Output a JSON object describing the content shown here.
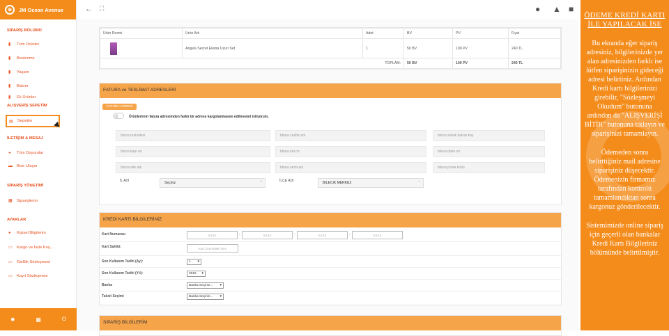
{
  "brand": {
    "name": "JM Ocean Avenue",
    "logo_glyph": "⊛"
  },
  "sidebar": {
    "sections": [
      {
        "title": "SİPARİŞ BÖLÜMÜ"
      },
      {
        "title": "ALIŞVERİŞ SEPETİM"
      },
      {
        "title": "İLETİŞİM & MESAJ"
      },
      {
        "title": "SİPARİŞ YÖNETİMİ"
      },
      {
        "title": "AYARLAR"
      }
    ],
    "items": [
      {
        "label": "Tüm Ürünler",
        "icon": "bookmark-icon"
      },
      {
        "label": "Beslenme",
        "icon": "bookmark-icon"
      },
      {
        "label": "Yaşam",
        "icon": "bookmark-icon"
      },
      {
        "label": "Bakım",
        "icon": "bookmark-icon"
      },
      {
        "label": "Ek Ürünler",
        "icon": "bookmark-icon"
      },
      {
        "label": "Sepetim",
        "icon": "cart-icon"
      },
      {
        "label": "Tüm Duyurular",
        "icon": "megaphone-icon"
      },
      {
        "label": "Bize Ulaşın",
        "icon": "message-icon"
      },
      {
        "label": "Siparişlerim",
        "icon": "grid-icon"
      },
      {
        "label": "Kişisel Bilgilerim",
        "icon": "info-icon"
      },
      {
        "label": "Kargo ve İade Koş...",
        "icon": "truck-icon"
      },
      {
        "label": "Gizlilik Sözleşmesi",
        "icon": "doc-icon"
      },
      {
        "label": "Kayıt Sözleşmesi",
        "icon": "doc-icon"
      }
    ],
    "footer_icons": [
      "gear-icon",
      "apps-icon",
      "power-icon"
    ]
  },
  "product_table": {
    "headers": [
      "Ürün Resmi",
      "Ürün Adı",
      "Adet",
      "BV",
      "PV",
      "Fiyat"
    ],
    "rows": [
      [
        "",
        "Angels Secret Ekstra Uzun Set",
        "1",
        "50 BV",
        "100 PV",
        "240 TL"
      ]
    ],
    "total_label": "TOPLAM:",
    "total_bv": "50 BV",
    "total_pv": "100 PV",
    "total_price": "240 TL"
  },
  "address": {
    "title": "FATURA ve TESLİMAT ADRESLERİ",
    "tag": "FATURA ADRESİ",
    "toggle_text": "Ürünlerimin fatura adresimden farklı bir adrese kargolanmasını edilmesini istiyorum.",
    "placeholders": [
      "fatura mahallesi",
      "fatura cadde adı",
      "fatura sokak bulvar koy",
      "fatura kapı no",
      "fatura kat no",
      "fatura daire no",
      "fatura site adı",
      "fatura semt adı",
      "fatura posta kodu"
    ],
    "il_label": "İL ADI",
    "il_value": "Seçiniz",
    "ilce_label": "İLÇE ADI",
    "ilce_value": "BILECIK MERKEZ"
  },
  "card": {
    "title": "KREDİ KARTI BİLGİLERİNİZ",
    "labels": [
      "Kart Numarası",
      "Kart Sahibi:",
      "Son Kullanım Tarihi (Ay):",
      "Son Kullanım Tarihi (Yıl):",
      "Banka",
      "Taksit Seçimi"
    ],
    "number_placeholder": "XXXX",
    "dash": "-",
    "holder_placeholder": "Kart Üzerindeki İsim",
    "month": "1",
    "year": "2015",
    "bank": "Banka Seçiniz...",
    "installment": "Banka Seçiniz..."
  },
  "order": {
    "title": "SİPARİŞ BİLGİLERİM"
  },
  "panel": {
    "title": "ÖDEME KREDİ KARTI İLE YAPILACAK İSE",
    "p1": "Bu ekranda eğer sipariş adresiniz, bilgilerinizde yer alan adresinizden farklı ise lütfen siparişinizin gideceği adresi belirtiniz. Ardından Kredi kartı bilgilerinizi girebilir, \"Sözleşmeyi Okudum\" butonuna ardından da \"ALIŞVERİŞİ BİTİR\" butonuna tıklayın ve siparişinizi tamamlayın.",
    "p2": "Ödemeden sonra belirttiğiniz mail adresine siparişiniz düşecektir. Ödemenizin firmamız tarafından kontrolü tamamlandıktan sonra kargonuz gönderilecektir.",
    "p3": "Sistemimizde online sipariş için geçerli olan bankalar Kredi Kartı Bilgileriniz bölümünde belirtilmiştir."
  },
  "colors": {
    "accent": "#f48c1c",
    "header": "#f6a44a",
    "link": "#e8501e"
  }
}
